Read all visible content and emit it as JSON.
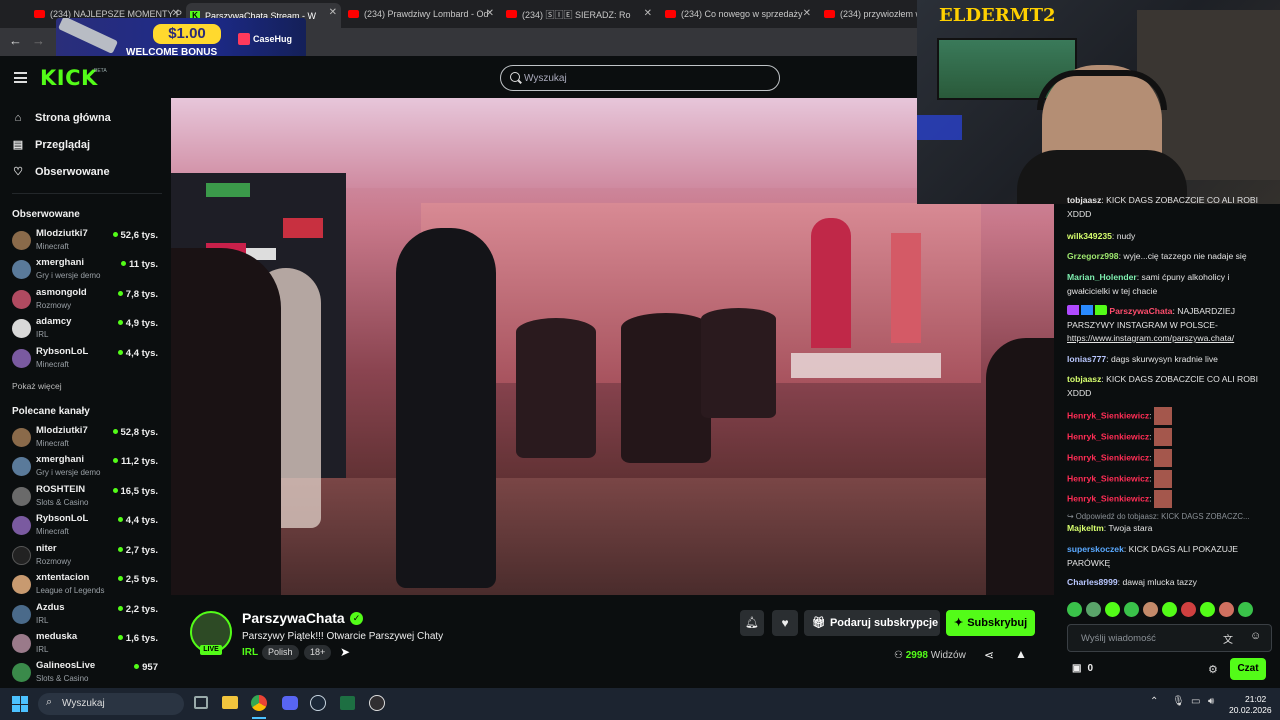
{
  "browser": {
    "tabs": [
      {
        "title": "(234) NAJLEPSZE MOMENTY P",
        "icon": "youtube-icon",
        "active": false
      },
      {
        "title": "ParszywaChata Stream - W",
        "icon": "kick-icon",
        "active": true
      },
      {
        "title": "(234) Prawdziwy Lombard - Od",
        "icon": "youtube-icon",
        "active": false
      },
      {
        "title": "(234) 🅂🄸🄴 SIERADZ: Ro",
        "icon": "youtube-icon",
        "active": false
      },
      {
        "title": "(234) Co nowego w sprzedaży",
        "icon": "youtube-icon",
        "active": false
      },
      {
        "title": "(234) przywiozłem wie",
        "icon": "youtube-icon",
        "active": false
      }
    ],
    "ad": {
      "amount": "$1.00",
      "text": "WELCOME BONUS",
      "brand": "CaseHug"
    }
  },
  "kick": {
    "logo": "KICK",
    "beta": "BETA",
    "search_placeholder": "Wyszukaj",
    "accent": "#53fc18"
  },
  "sidebar": {
    "nav": [
      {
        "label": "Strona główna",
        "icon": "home-icon"
      },
      {
        "label": "Przeglądaj",
        "icon": "browse-icon"
      },
      {
        "label": "Obserwowane",
        "icon": "heart-icon"
      }
    ],
    "followed_title": "Obserwowane",
    "followed": [
      {
        "name": "Mlodziutki7",
        "category": "Minecraft",
        "viewers": "52,6 tys."
      },
      {
        "name": "xmerghani",
        "category": "Gry i wersje demo",
        "viewers": "11 tys."
      },
      {
        "name": "asmongold",
        "category": "Rozmowy",
        "viewers": "7,8 tys."
      },
      {
        "name": "adamcy",
        "category": "IRL",
        "viewers": "4,9 tys."
      },
      {
        "name": "RybsonLoL",
        "category": "Minecraft",
        "viewers": "4,4 tys."
      }
    ],
    "show_more": "Pokaż więcej",
    "recommended_title": "Polecane kanały",
    "recommended": [
      {
        "name": "Mlodziutki7",
        "category": "Minecraft",
        "viewers": "52,8 tys."
      },
      {
        "name": "xmerghani",
        "category": "Gry i wersje demo",
        "viewers": "11,2 tys."
      },
      {
        "name": "ROSHTEIN",
        "category": "Slots & Casino",
        "viewers": "16,5 tys."
      },
      {
        "name": "RybsonLoL",
        "category": "Minecraft",
        "viewers": "4,4 tys."
      },
      {
        "name": "niter",
        "category": "Rozmowy",
        "viewers": "2,7 tys."
      },
      {
        "name": "xntentacion",
        "category": "League of Legends",
        "viewers": "2,5 tys."
      },
      {
        "name": "Azdus",
        "category": "IRL",
        "viewers": "2,2 tys."
      },
      {
        "name": "meduska",
        "category": "IRL",
        "viewers": "1,6 tys."
      },
      {
        "name": "GalineosLive",
        "category": "Slots & Casino",
        "viewers": "957"
      }
    ]
  },
  "stream": {
    "channel": "ParszywaChata",
    "live_badge": "LIVE",
    "title": "Parszywy Piątek!!! Otwarcie Parszywej Chaty",
    "category": "IRL",
    "tags": [
      "Polish",
      "18+"
    ],
    "gift_label": "Podaruj subskrypcje",
    "subscribe_label": "Subskrybuj",
    "viewers": "2998",
    "viewers_label": "Widzów",
    "webcam_overlay": "ELDERMT2"
  },
  "chat": {
    "messages": [
      {
        "user": "tobjaasz",
        "color": "#e4e4e4",
        "text": "KICK DAGS ZOBACZCIE CO ALI ROBI XDDD"
      },
      {
        "user": "wilk349235",
        "color": "#d7ff6e",
        "text": "nudy"
      },
      {
        "user": "Grzegorz998",
        "color": "#9ee86f",
        "text": "wyje...cię tazzego nie nadaje się"
      },
      {
        "user": "Marian_Holender",
        "color": "#7ff0b0",
        "text": "sami ćpuny alkoholicy i gwałcicielki w tej chacie"
      },
      {
        "user": "ParszywaChata",
        "color": "#ff4d6d",
        "text": "NAJBARDZIEJ PARSZYWY INSTAGRAM W POLSCE-",
        "link": "https://www.instagram.com/parszywa.chata/"
      },
      {
        "user": "lonias777",
        "color": "#b9c7ff",
        "text": "dags skurwysyn kradnie live"
      },
      {
        "user": "tobjaasz",
        "color": "#d7ff6e",
        "text": "KICK DAGS ZOBACZCIE CO ALI ROBI XDDD"
      },
      {
        "user": "Henryk_Sienkiewicz",
        "color": "#ff2d55",
        "text": ""
      },
      {
        "user": "Henryk_Sienkiewicz",
        "color": "#ff2d55",
        "text": ""
      },
      {
        "user": "Henryk_Sienkiewicz",
        "color": "#ff2d55",
        "text": ""
      },
      {
        "user": "Henryk_Sienkiewicz",
        "color": "#ff2d55",
        "text": ""
      },
      {
        "user": "Henryk_Sienkiewicz",
        "color": "#ff2d55",
        "text": ""
      },
      {
        "user": "Majkeltm",
        "color": "#d7ff6e",
        "text": "Twoja stara",
        "reply": "Odpowiedź do tobjaasz: KICK DAGS ZOBACZC..."
      },
      {
        "user": "superskoczek",
        "color": "#5aa9ff",
        "text": "KICK DAGS ALI POKAZUJE PARÓWKĘ"
      },
      {
        "user": "Charles8999",
        "color": "#b9c7ff",
        "text": "dawaj mlucka tazzy"
      }
    ],
    "input_placeholder": "Wyślij wiadomość",
    "points": "0",
    "send_label": "Czat"
  },
  "taskbar": {
    "search_label": "Wyszukaj",
    "time": "21:02",
    "date": "20.02.2026"
  }
}
